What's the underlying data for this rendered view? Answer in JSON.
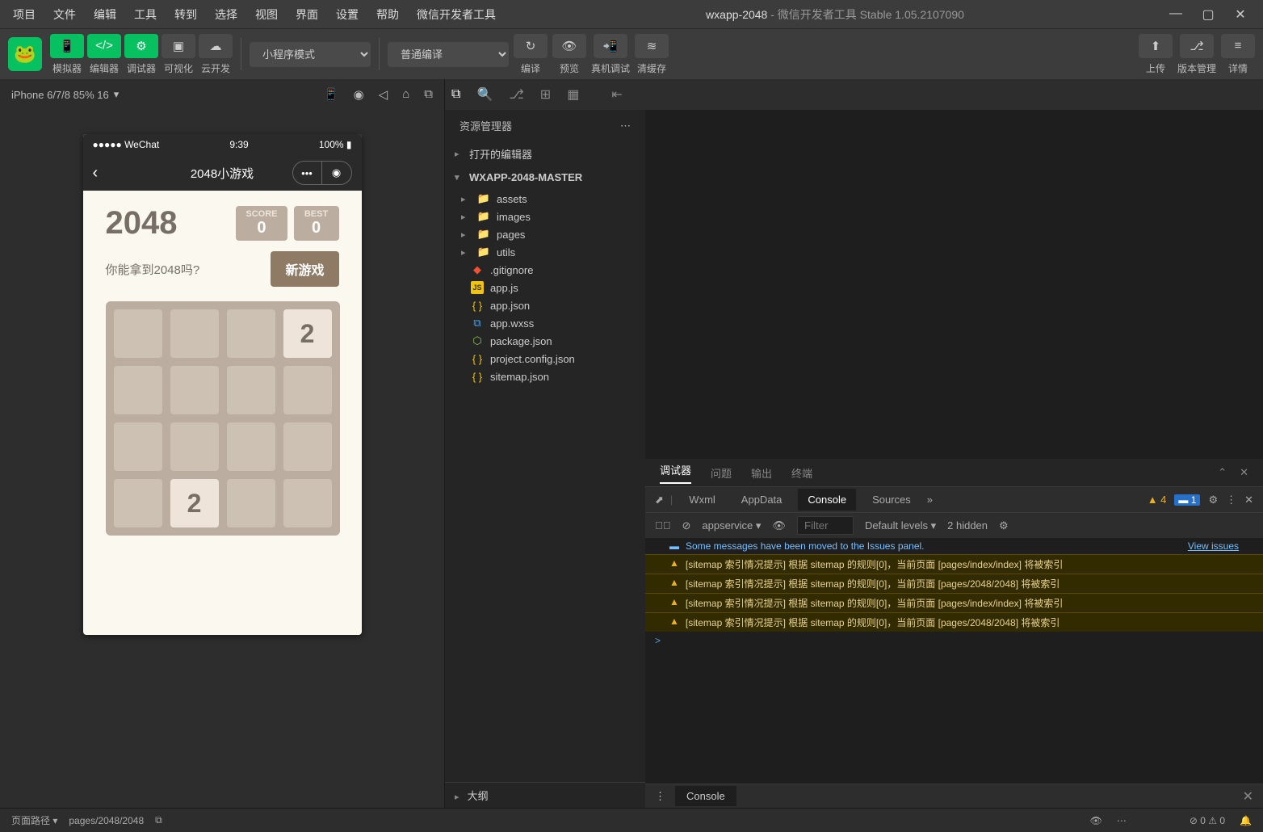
{
  "menus": [
    "项目",
    "文件",
    "编辑",
    "工具",
    "转到",
    "选择",
    "视图",
    "界面",
    "设置",
    "帮助",
    "微信开发者工具"
  ],
  "window": {
    "project": "wxapp-2048",
    "subtitle": "微信开发者工具 Stable 1.05.2107090"
  },
  "toolbar": {
    "labels": [
      "模拟器",
      "编辑器",
      "调试器",
      "可视化",
      "云开发"
    ],
    "mode": "小程序模式",
    "compile": "普通编译",
    "actions": {
      "compile": "编译",
      "preview": "预览",
      "remote": "真机调试",
      "cache": "清缓存"
    },
    "right": {
      "upload": "上传",
      "vcs": "版本管理",
      "detail": "详情"
    }
  },
  "sim": {
    "device": "iPhone 6/7/8 85% 16",
    "status_left": "●●●●● WeChat",
    "status_time": "9:39",
    "status_right": "100%",
    "nav_title": "2048小游戏"
  },
  "game": {
    "title": "2048",
    "score_label": "SCORE",
    "score": "0",
    "best_label": "BEST",
    "best": "0",
    "subtitle": "你能拿到2048吗?",
    "new_game": "新游戏",
    "tiles": [
      null,
      null,
      null,
      "2",
      null,
      null,
      null,
      null,
      null,
      null,
      null,
      null,
      null,
      "2",
      null,
      null
    ]
  },
  "explorer": {
    "title": "资源管理器",
    "open_editors": "打开的编辑器",
    "root": "WXAPP-2048-MASTER",
    "folders": [
      "assets",
      "images",
      "pages",
      "utils"
    ],
    "files": [
      {
        "name": ".gitignore",
        "icon": "git"
      },
      {
        "name": "app.js",
        "icon": "js"
      },
      {
        "name": "app.json",
        "icon": "json"
      },
      {
        "name": "app.wxss",
        "icon": "css"
      },
      {
        "name": "package.json",
        "icon": "pkg"
      },
      {
        "name": "project.config.json",
        "icon": "json"
      },
      {
        "name": "sitemap.json",
        "icon": "json"
      }
    ],
    "outline": "大纲"
  },
  "debugger": {
    "tabs": [
      "调试器",
      "问题",
      "输出",
      "终端"
    ],
    "dev_tabs": [
      "Wxml",
      "AppData",
      "Console",
      "Sources"
    ],
    "warn_count": "4",
    "info_count": "1",
    "context": "appservice",
    "filter_placeholder": "Filter",
    "levels": "Default levels",
    "hidden": "2 hidden",
    "info_msg": "Some messages have been moved to the Issues panel.",
    "view_issues": "View issues",
    "warnings": [
      "[sitemap 索引情况提示] 根据 sitemap 的规则[0]，当前页面 [pages/index/index] 将被索引",
      "[sitemap 索引情况提示] 根据 sitemap 的规则[0]，当前页面 [pages/2048/2048] 将被索引",
      "[sitemap 索引情况提示] 根据 sitemap 的规则[0]，当前页面 [pages/index/index] 将被索引",
      "[sitemap 索引情况提示] 根据 sitemap 的规则[0]，当前页面 [pages/2048/2048] 将被索引"
    ],
    "drawer": "Console"
  },
  "status": {
    "path_label": "页面路径",
    "path": "pages/2048/2048",
    "errors": "0",
    "warnings": "0"
  }
}
